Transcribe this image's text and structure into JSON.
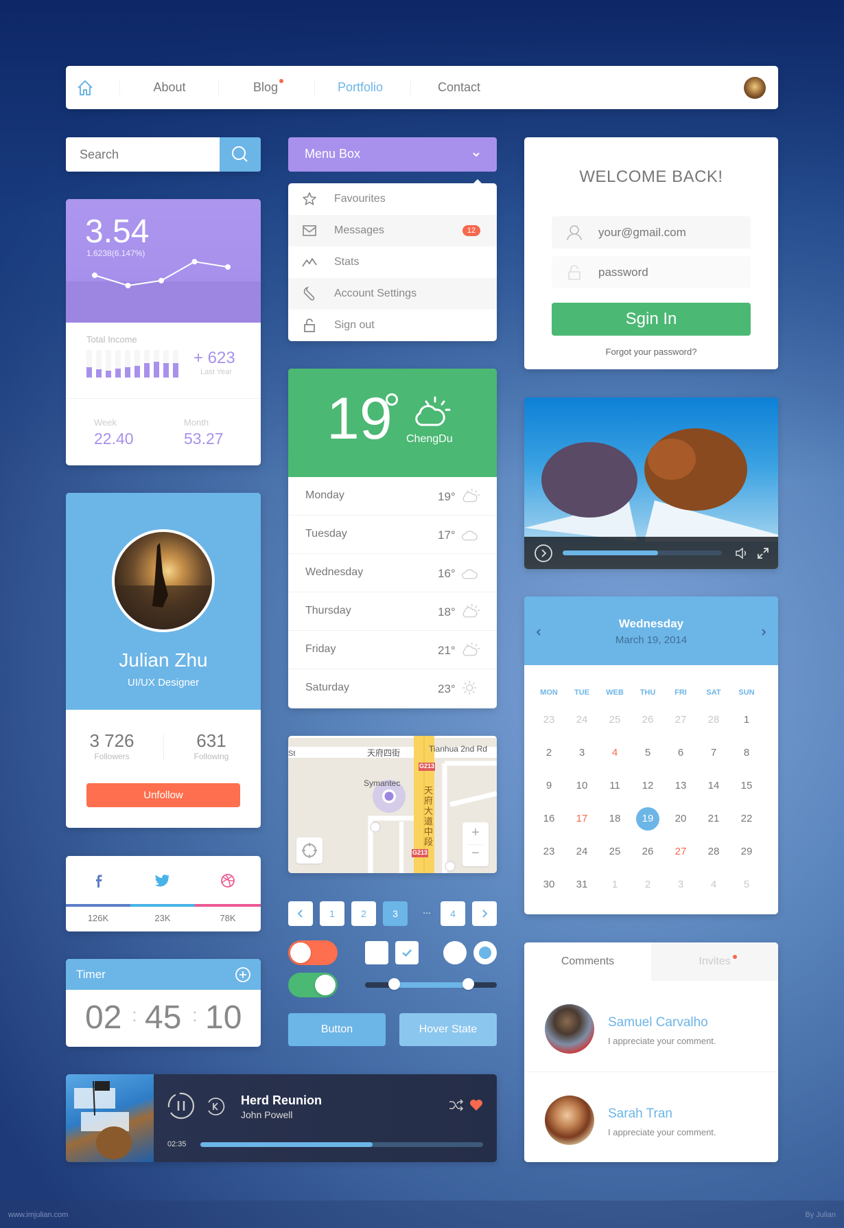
{
  "nav": {
    "items": [
      {
        "label": "About",
        "active": false,
        "notification": false
      },
      {
        "label": "Blog",
        "active": false,
        "notification": true
      },
      {
        "label": "Portfolio",
        "active": true,
        "notification": false
      },
      {
        "label": "Contact",
        "active": false,
        "notification": false
      }
    ],
    "home_icon": "home-icon",
    "avatar": "user-avatar"
  },
  "search": {
    "placeholder": "Search",
    "icon": "search-icon"
  },
  "stats_card": {
    "value": "3.54",
    "change": "1.6238(6.147%)",
    "line_points": [
      0.45,
      0.2,
      0.32,
      0.78,
      0.65
    ],
    "income_label": "Total Income",
    "income_bars": [
      0.38,
      0.3,
      0.25,
      0.33,
      0.38,
      0.42,
      0.53,
      0.58,
      0.53,
      0.53
    ],
    "income_value": "+ 623",
    "income_sub": "Last Year",
    "week_label": "Week",
    "week_value": "22.40",
    "month_label": "Month",
    "month_value": "53.27"
  },
  "menu": {
    "title": "Menu Box",
    "items": [
      {
        "label": "Favourites",
        "icon": "star-icon"
      },
      {
        "label": "Messages",
        "icon": "mail-icon",
        "badge": "12"
      },
      {
        "label": "Stats",
        "icon": "stats-icon"
      },
      {
        "label": "Account Settings",
        "icon": "wrench-icon"
      },
      {
        "label": "Sign out",
        "icon": "lock-icon"
      }
    ]
  },
  "login": {
    "title": "WELCOME BACK!",
    "email_value": "your@gmail.com",
    "password_placeholder": "password",
    "submit": "Sgin In",
    "forgot": "Forgot your password?"
  },
  "weather": {
    "temp": "19",
    "city": "ChengDu",
    "days": [
      {
        "day": "Monday",
        "temp": "19°",
        "icon": "partly-cloudy-icon"
      },
      {
        "day": "Tuesday",
        "temp": "17°",
        "icon": "cloud-icon"
      },
      {
        "day": "Wednesday",
        "temp": "16°",
        "icon": "cloud-icon"
      },
      {
        "day": "Thursday",
        "temp": "18°",
        "icon": "partly-cloudy-icon"
      },
      {
        "day": "Friday",
        "temp": "21°",
        "icon": "partly-cloudy-icon"
      },
      {
        "day": "Saturday",
        "temp": "23°",
        "icon": "sun-icon"
      }
    ]
  },
  "map": {
    "labels": [
      "天府四街",
      "Tianhua 2nd Rd",
      "Symantec",
      "天府大道中段",
      "G213",
      "G213",
      "St"
    ],
    "zoom_in": "+",
    "zoom_out": "−"
  },
  "pagination": {
    "pages": [
      "1",
      "2",
      "3",
      "4"
    ],
    "current": "3",
    "ellipsis": "..."
  },
  "controls": {
    "toggle_off_color": "#fd6f4e",
    "toggle_on_color": "#4bb874",
    "checkbox_states": [
      false,
      true
    ],
    "radio_states": [
      false,
      true
    ],
    "range_low": 0.22,
    "range_high": 0.78,
    "button_label": "Button",
    "hover_label": "Hover State"
  },
  "video": {
    "progress": 0.6
  },
  "calendar": {
    "day_name": "Wednesday",
    "date": "March 19, 2014",
    "weekdays": [
      "MON",
      "TUE",
      "WEB",
      "THU",
      "FRI",
      "SAT",
      "SUN"
    ],
    "weeks": [
      [
        {
          "d": "23",
          "m": 1
        },
        {
          "d": "24",
          "m": 1
        },
        {
          "d": "25",
          "m": 1
        },
        {
          "d": "26",
          "m": 1
        },
        {
          "d": "27",
          "m": 1
        },
        {
          "d": "28",
          "m": 1
        },
        {
          "d": "1"
        }
      ],
      [
        {
          "d": "2"
        },
        {
          "d": "3"
        },
        {
          "d": "4",
          "r": 1
        },
        {
          "d": "5"
        },
        {
          "d": "6"
        },
        {
          "d": "7"
        },
        {
          "d": "8"
        }
      ],
      [
        {
          "d": "9"
        },
        {
          "d": "10"
        },
        {
          "d": "11"
        },
        {
          "d": "12"
        },
        {
          "d": "13"
        },
        {
          "d": "14"
        },
        {
          "d": "15"
        }
      ],
      [
        {
          "d": "16"
        },
        {
          "d": "17",
          "r": 1
        },
        {
          "d": "18"
        },
        {
          "d": "19",
          "s": 1
        },
        {
          "d": "20"
        },
        {
          "d": "21"
        },
        {
          "d": "22"
        }
      ],
      [
        {
          "d": "23"
        },
        {
          "d": "24"
        },
        {
          "d": "25"
        },
        {
          "d": "26"
        },
        {
          "d": "27",
          "r": 1
        },
        {
          "d": "28"
        },
        {
          "d": "29"
        }
      ],
      [
        {
          "d": "30"
        },
        {
          "d": "31"
        },
        {
          "d": "1",
          "m": 1
        },
        {
          "d": "2",
          "m": 1
        },
        {
          "d": "3",
          "m": 1
        },
        {
          "d": "4",
          "m": 1
        },
        {
          "d": "5",
          "m": 1
        }
      ]
    ]
  },
  "profile": {
    "name": "Julian Zhu",
    "role": "UI/UX Designer",
    "followers": "3 726",
    "followers_label": "Followers",
    "following": "631",
    "following_label": "Following",
    "action": "Unfollow"
  },
  "social": [
    {
      "network": "facebook",
      "count": "126K",
      "color": "#5d7dc6"
    },
    {
      "network": "twitter",
      "count": "23K",
      "color": "#48b3e8"
    },
    {
      "network": "dribbble",
      "count": "78K",
      "color": "#ec5a93"
    }
  ],
  "timer": {
    "title": "Timer",
    "hours": "02",
    "minutes": "45",
    "seconds": "10"
  },
  "player": {
    "title": "Herd Reunion",
    "artist": "John Powell",
    "time": "02:35",
    "progress": 0.61
  },
  "comments": {
    "tabs": [
      {
        "label": "Comments",
        "active": true
      },
      {
        "label": "Invites",
        "active": false,
        "notification": true
      }
    ],
    "items": [
      {
        "name": "Samuel Carvalho",
        "text": "I appreciate your comment."
      },
      {
        "name": "Sarah Tran",
        "text": "I appreciate your comment."
      }
    ]
  },
  "footer": {
    "left": "www.imjulian.com",
    "right": "By Julian"
  }
}
